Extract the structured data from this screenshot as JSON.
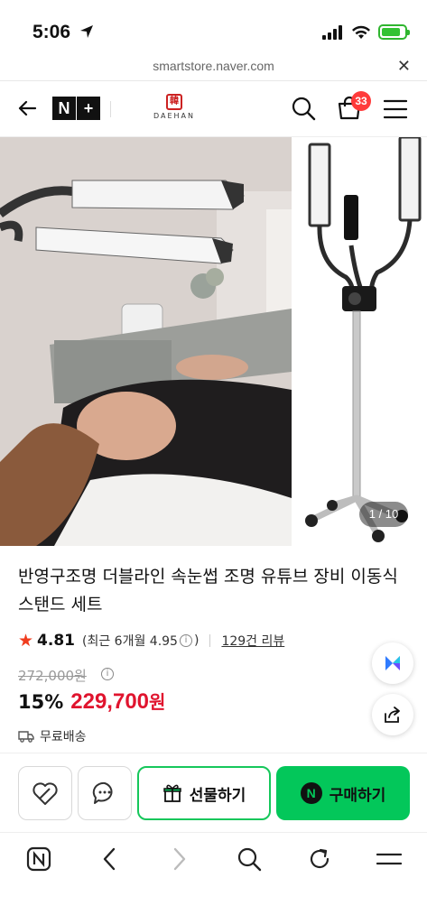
{
  "status_bar": {
    "time": "5:06"
  },
  "url_bar": {
    "url": "smartstore.naver.com"
  },
  "header": {
    "nplus_n": "N",
    "nplus_plus": "+",
    "brand_logo_char": "韓",
    "brand_name": "DAEHAN",
    "cart_count": "33"
  },
  "gallery": {
    "counter": "1 / 10"
  },
  "product": {
    "title": "반영구조명 더블라인 속눈썹 조명 유튜브 장비 이동식 스탠드 세트",
    "rating": "4.81",
    "recent_label": "(최근 6개월 4.95",
    "recent_close": ")",
    "review_count": "129건 리뷰",
    "original_price": "272,000원",
    "discount": "15%",
    "price": "229,700",
    "currency": "원",
    "shipping": "무료배송"
  },
  "actions": {
    "gift_label": "선물하기",
    "buy_label": "구매하기",
    "npay_mark": "N"
  },
  "colors": {
    "price_red": "#e0142e",
    "naver_green": "#03c75a",
    "badge_red": "#ff3b3b",
    "star": "#f03c1e"
  }
}
